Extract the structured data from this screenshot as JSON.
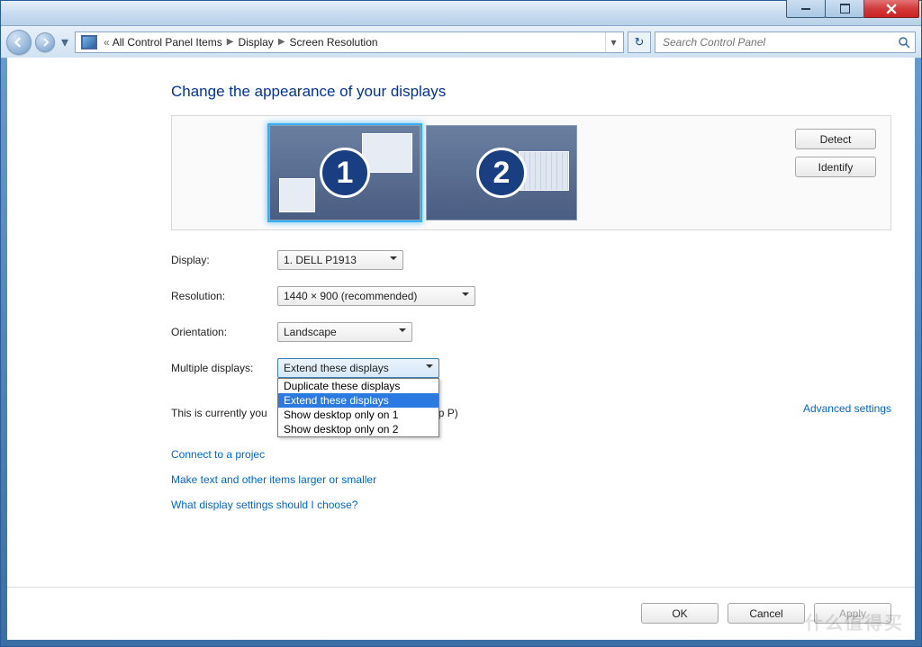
{
  "titlebar": {},
  "breadcrumb": {
    "back_sep": "«",
    "level1": "All Control Panel Items",
    "level2": "Display",
    "level3": "Screen Resolution"
  },
  "search": {
    "placeholder": "Search Control Panel"
  },
  "page": {
    "title": "Change the appearance of your displays",
    "primary_line_prefix": "This is currently you",
    "primary_line_suffix": "tap P)"
  },
  "side_buttons": {
    "detect": "Detect",
    "identify": "Identify"
  },
  "monitors": {
    "m1": "1",
    "m2": "2"
  },
  "labels": {
    "display": "Display:",
    "resolution": "Resolution:",
    "orientation": "Orientation:",
    "multiple": "Multiple displays:"
  },
  "values": {
    "display": "1. DELL P1913",
    "resolution": "1440 × 900 (recommended)",
    "orientation": "Landscape",
    "multiple": "Extend these displays"
  },
  "multiple_options": {
    "o1": "Duplicate these displays",
    "o2": "Extend these displays",
    "o3": "Show desktop only on 1",
    "o4": "Show desktop only on 2"
  },
  "links": {
    "advanced": "Advanced settings",
    "projector": "Connect to a projec",
    "textsize": "Make text and other items larger or smaller",
    "help": "What display settings should I choose?"
  },
  "footer": {
    "ok": "OK",
    "cancel": "Cancel",
    "apply": "Apply"
  },
  "watermark": "什么值得买"
}
